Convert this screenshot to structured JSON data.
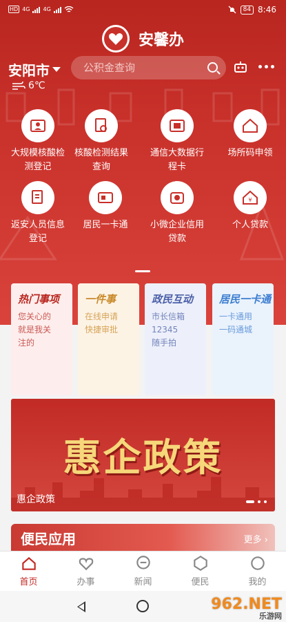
{
  "status_bar": {
    "left_tags": [
      "HD",
      "4G",
      "4G"
    ],
    "battery": "84",
    "time": "8:46"
  },
  "brand": {
    "title": "安馨办"
  },
  "topbar": {
    "city": "安阳市",
    "search_placeholder": "公积金查询"
  },
  "weather": {
    "temp": "6℃",
    "icon": "wind-icon"
  },
  "services": [
    {
      "label": "大规模核酸检测登记",
      "icon": "id-person-icon"
    },
    {
      "label": "核酸检测结果查询",
      "icon": "document-search-icon"
    },
    {
      "label": "通信大数据行程卡",
      "icon": "card-icon"
    },
    {
      "label": "场所码申领",
      "icon": "house-icon"
    },
    {
      "label": "返安人员信息登记",
      "icon": "document-edit-icon"
    },
    {
      "label": "居民一卡通",
      "icon": "id-card-icon"
    },
    {
      "label": "小微企业信用贷款",
      "icon": "benefit-icon"
    },
    {
      "label": "个人贷款",
      "icon": "yen-house-icon"
    }
  ],
  "cards": [
    {
      "title": "热门事项",
      "lines": [
        "您关心的",
        "就是我关",
        "注的"
      ],
      "color": "#b8261f",
      "bg": "#fdeeed"
    },
    {
      "title": "一件事",
      "lines": [
        "在线申请",
        "快捷审批"
      ],
      "color": "#c98a2a",
      "bg": "#fdf3e5"
    },
    {
      "title": "政民互动",
      "lines": [
        "市长信箱",
        "12345",
        "随手拍"
      ],
      "color": "#4b5fa8",
      "bg": "#edf0fa"
    },
    {
      "title": "居民一卡通",
      "lines": [
        "一卡通用",
        "一码通城"
      ],
      "color": "#3c7ed0",
      "bg": "#eaf2fc"
    }
  ],
  "banner": {
    "title": "惠企政策",
    "caption": "惠企政策"
  },
  "apps": {
    "title": "便民应用",
    "more": "更多"
  },
  "tabs": [
    {
      "label": "首页",
      "icon": "home-icon",
      "active": true
    },
    {
      "label": "办事",
      "icon": "heart-icon",
      "active": false
    },
    {
      "label": "新闻",
      "icon": "chat-icon",
      "active": false
    },
    {
      "label": "便民",
      "icon": "hexagon-icon",
      "active": false
    },
    {
      "label": "我的",
      "icon": "person-icon",
      "active": false
    }
  ],
  "watermark": {
    "brand": "962.NET",
    "sub": "乐游网"
  },
  "colors": {
    "primary": "#c8302a",
    "gold": "#f6d77a"
  }
}
